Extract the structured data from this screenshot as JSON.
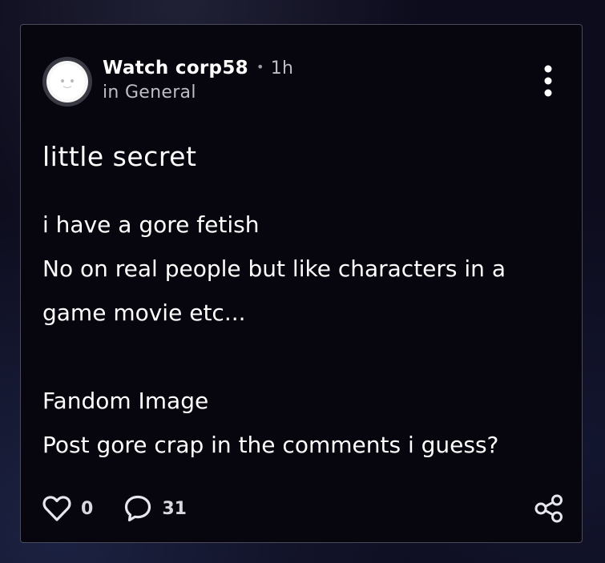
{
  "post": {
    "author": "Watch corp58",
    "separator": "•",
    "time": "1h",
    "category": "in General",
    "title": "little secret",
    "body": {
      "line1": "i have a gore fetish",
      "line2": "No on real people but like characters in a",
      "line3": "game movie etc...",
      "line4": "Fandom Image",
      "line5": "Post gore crap in the comments i guess?"
    },
    "likes": "0",
    "comments": "31"
  },
  "icons": {
    "avatar": "avatar-image",
    "more": "vertical-dots-icon",
    "like": "heart-icon",
    "comment": "speech-bubble-icon",
    "share": "share-icon"
  },
  "colors": {
    "card_background": "#07060f",
    "card_border": "#4a4a5a",
    "text_primary": "#ffffff",
    "text_secondary": "#bdbdc8"
  }
}
